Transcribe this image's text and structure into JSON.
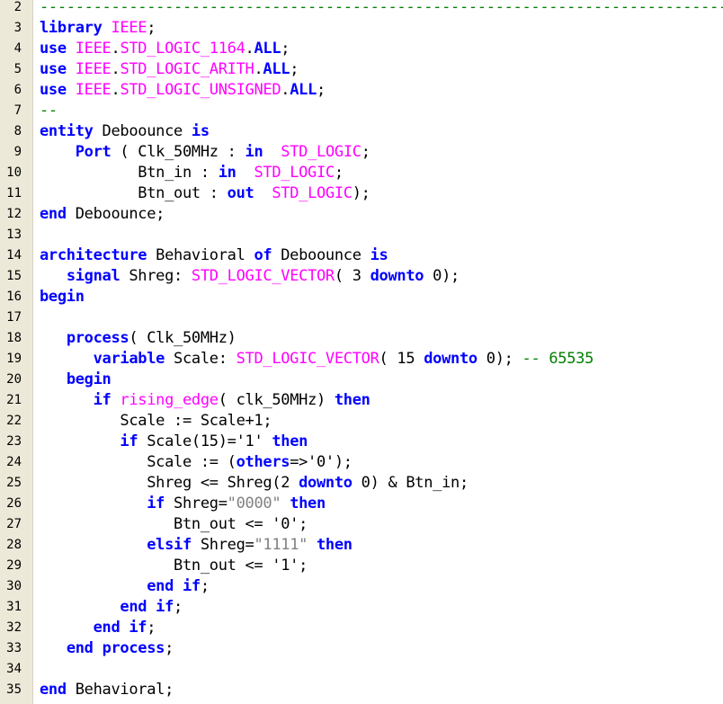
{
  "colors": {
    "keyword": "#0000ff",
    "type": "#ff00ff",
    "comment": "#008000",
    "string": "#808080",
    "text": "#000000",
    "gutter_bg": "#ece9d8"
  },
  "lines": [
    {
      "n": "2",
      "tokens": [
        {
          "t": "cm",
          "v": "-----------------------------------------------------------------------------"
        }
      ]
    },
    {
      "n": "3",
      "tokens": [
        {
          "t": "kw",
          "v": "library"
        },
        {
          "t": "tx",
          "v": " "
        },
        {
          "t": "ty",
          "v": "IEEE"
        },
        {
          "t": "tx",
          "v": ";"
        }
      ]
    },
    {
      "n": "4",
      "tokens": [
        {
          "t": "kw",
          "v": "use"
        },
        {
          "t": "tx",
          "v": " "
        },
        {
          "t": "ty",
          "v": "IEEE"
        },
        {
          "t": "tx",
          "v": "."
        },
        {
          "t": "ty",
          "v": "STD_LOGIC_1164"
        },
        {
          "t": "tx",
          "v": "."
        },
        {
          "t": "kw",
          "v": "ALL"
        },
        {
          "t": "tx",
          "v": ";"
        }
      ]
    },
    {
      "n": "5",
      "tokens": [
        {
          "t": "kw",
          "v": "use"
        },
        {
          "t": "tx",
          "v": " "
        },
        {
          "t": "ty",
          "v": "IEEE"
        },
        {
          "t": "tx",
          "v": "."
        },
        {
          "t": "ty",
          "v": "STD_LOGIC_ARITH"
        },
        {
          "t": "tx",
          "v": "."
        },
        {
          "t": "kw",
          "v": "ALL"
        },
        {
          "t": "tx",
          "v": ";"
        }
      ]
    },
    {
      "n": "6",
      "tokens": [
        {
          "t": "kw",
          "v": "use"
        },
        {
          "t": "tx",
          "v": " "
        },
        {
          "t": "ty",
          "v": "IEEE"
        },
        {
          "t": "tx",
          "v": "."
        },
        {
          "t": "ty",
          "v": "STD_LOGIC_UNSIGNED"
        },
        {
          "t": "tx",
          "v": "."
        },
        {
          "t": "kw",
          "v": "ALL"
        },
        {
          "t": "tx",
          "v": ";"
        }
      ]
    },
    {
      "n": "7",
      "tokens": [
        {
          "t": "cm",
          "v": "--"
        }
      ]
    },
    {
      "n": "8",
      "tokens": [
        {
          "t": "kw",
          "v": "entity"
        },
        {
          "t": "tx",
          "v": " Deboounce "
        },
        {
          "t": "kw",
          "v": "is"
        }
      ]
    },
    {
      "n": "9",
      "tokens": [
        {
          "t": "tx",
          "v": "    "
        },
        {
          "t": "kw",
          "v": "Port"
        },
        {
          "t": "tx",
          "v": " ( Clk_50MHz : "
        },
        {
          "t": "kw",
          "v": "in"
        },
        {
          "t": "tx",
          "v": "  "
        },
        {
          "t": "ty",
          "v": "STD_LOGIC"
        },
        {
          "t": "tx",
          "v": ";"
        }
      ]
    },
    {
      "n": "10",
      "tokens": [
        {
          "t": "tx",
          "v": "           Btn_in : "
        },
        {
          "t": "kw",
          "v": "in"
        },
        {
          "t": "tx",
          "v": "  "
        },
        {
          "t": "ty",
          "v": "STD_LOGIC"
        },
        {
          "t": "tx",
          "v": ";"
        }
      ]
    },
    {
      "n": "11",
      "tokens": [
        {
          "t": "tx",
          "v": "           Btn_out : "
        },
        {
          "t": "kw",
          "v": "out"
        },
        {
          "t": "tx",
          "v": "  "
        },
        {
          "t": "ty",
          "v": "STD_LOGIC"
        },
        {
          "t": "tx",
          "v": ");"
        }
      ]
    },
    {
      "n": "12",
      "tokens": [
        {
          "t": "kw",
          "v": "end"
        },
        {
          "t": "tx",
          "v": " Deboounce;"
        }
      ]
    },
    {
      "n": "13",
      "tokens": []
    },
    {
      "n": "14",
      "tokens": [
        {
          "t": "kw",
          "v": "architecture"
        },
        {
          "t": "tx",
          "v": " Behavioral "
        },
        {
          "t": "kw",
          "v": "of"
        },
        {
          "t": "tx",
          "v": " Deboounce "
        },
        {
          "t": "kw",
          "v": "is"
        }
      ]
    },
    {
      "n": "15",
      "tokens": [
        {
          "t": "tx",
          "v": "   "
        },
        {
          "t": "kw",
          "v": "signal"
        },
        {
          "t": "tx",
          "v": " Shreg: "
        },
        {
          "t": "ty",
          "v": "STD_LOGIC_VECTOR"
        },
        {
          "t": "tx",
          "v": "( 3 "
        },
        {
          "t": "kw",
          "v": "downto"
        },
        {
          "t": "tx",
          "v": " 0);"
        }
      ]
    },
    {
      "n": "16",
      "tokens": [
        {
          "t": "kw",
          "v": "begin"
        }
      ]
    },
    {
      "n": "17",
      "tokens": []
    },
    {
      "n": "18",
      "tokens": [
        {
          "t": "tx",
          "v": "   "
        },
        {
          "t": "kw",
          "v": "process"
        },
        {
          "t": "tx",
          "v": "( Clk_50MHz)"
        }
      ]
    },
    {
      "n": "19",
      "tokens": [
        {
          "t": "tx",
          "v": "      "
        },
        {
          "t": "kw",
          "v": "variable"
        },
        {
          "t": "tx",
          "v": " Scale: "
        },
        {
          "t": "ty",
          "v": "STD_LOGIC_VECTOR"
        },
        {
          "t": "tx",
          "v": "( 15 "
        },
        {
          "t": "kw",
          "v": "downto"
        },
        {
          "t": "tx",
          "v": " 0); "
        },
        {
          "t": "cm",
          "v": "-- 65535"
        }
      ]
    },
    {
      "n": "20",
      "tokens": [
        {
          "t": "tx",
          "v": "   "
        },
        {
          "t": "kw",
          "v": "begin"
        }
      ]
    },
    {
      "n": "21",
      "tokens": [
        {
          "t": "tx",
          "v": "      "
        },
        {
          "t": "kw",
          "v": "if"
        },
        {
          "t": "tx",
          "v": " "
        },
        {
          "t": "ty",
          "v": "rising_edge"
        },
        {
          "t": "tx",
          "v": "( clk_50MHz) "
        },
        {
          "t": "kw",
          "v": "then"
        }
      ]
    },
    {
      "n": "22",
      "tokens": [
        {
          "t": "tx",
          "v": "         Scale := Scale+1;"
        }
      ]
    },
    {
      "n": "23",
      "tokens": [
        {
          "t": "tx",
          "v": "         "
        },
        {
          "t": "kw",
          "v": "if"
        },
        {
          "t": "tx",
          "v": " Scale(15)='1' "
        },
        {
          "t": "kw",
          "v": "then"
        }
      ]
    },
    {
      "n": "24",
      "tokens": [
        {
          "t": "tx",
          "v": "            Scale := ("
        },
        {
          "t": "kw",
          "v": "others"
        },
        {
          "t": "tx",
          "v": "=>'0');"
        }
      ]
    },
    {
      "n": "25",
      "tokens": [
        {
          "t": "tx",
          "v": "            Shreg <= Shreg(2 "
        },
        {
          "t": "kw",
          "v": "downto"
        },
        {
          "t": "tx",
          "v": " 0) & Btn_in;"
        }
      ]
    },
    {
      "n": "26",
      "tokens": [
        {
          "t": "tx",
          "v": "            "
        },
        {
          "t": "kw",
          "v": "if"
        },
        {
          "t": "tx",
          "v": " Shreg="
        },
        {
          "t": "st",
          "v": "\"0000\""
        },
        {
          "t": "tx",
          "v": " "
        },
        {
          "t": "kw",
          "v": "then"
        }
      ]
    },
    {
      "n": "27",
      "tokens": [
        {
          "t": "tx",
          "v": "               Btn_out <= '0';"
        }
      ]
    },
    {
      "n": "28",
      "tokens": [
        {
          "t": "tx",
          "v": "            "
        },
        {
          "t": "kw",
          "v": "elsif"
        },
        {
          "t": "tx",
          "v": " Shreg="
        },
        {
          "t": "st",
          "v": "\"1111\""
        },
        {
          "t": "tx",
          "v": " "
        },
        {
          "t": "kw",
          "v": "then"
        }
      ]
    },
    {
      "n": "29",
      "tokens": [
        {
          "t": "tx",
          "v": "               Btn_out <= '1';"
        }
      ]
    },
    {
      "n": "30",
      "tokens": [
        {
          "t": "tx",
          "v": "            "
        },
        {
          "t": "kw",
          "v": "end"
        },
        {
          "t": "tx",
          "v": " "
        },
        {
          "t": "kw",
          "v": "if"
        },
        {
          "t": "tx",
          "v": ";"
        }
      ]
    },
    {
      "n": "31",
      "tokens": [
        {
          "t": "tx",
          "v": "         "
        },
        {
          "t": "kw",
          "v": "end"
        },
        {
          "t": "tx",
          "v": " "
        },
        {
          "t": "kw",
          "v": "if"
        },
        {
          "t": "tx",
          "v": ";"
        }
      ]
    },
    {
      "n": "32",
      "tokens": [
        {
          "t": "tx",
          "v": "      "
        },
        {
          "t": "kw",
          "v": "end"
        },
        {
          "t": "tx",
          "v": " "
        },
        {
          "t": "kw",
          "v": "if"
        },
        {
          "t": "tx",
          "v": ";"
        }
      ]
    },
    {
      "n": "33",
      "tokens": [
        {
          "t": "tx",
          "v": "   "
        },
        {
          "t": "kw",
          "v": "end"
        },
        {
          "t": "tx",
          "v": " "
        },
        {
          "t": "kw",
          "v": "process"
        },
        {
          "t": "tx",
          "v": ";"
        }
      ]
    },
    {
      "n": "34",
      "tokens": []
    },
    {
      "n": "35",
      "tokens": [
        {
          "t": "kw",
          "v": "end"
        },
        {
          "t": "tx",
          "v": " Behavioral;"
        }
      ]
    }
  ]
}
